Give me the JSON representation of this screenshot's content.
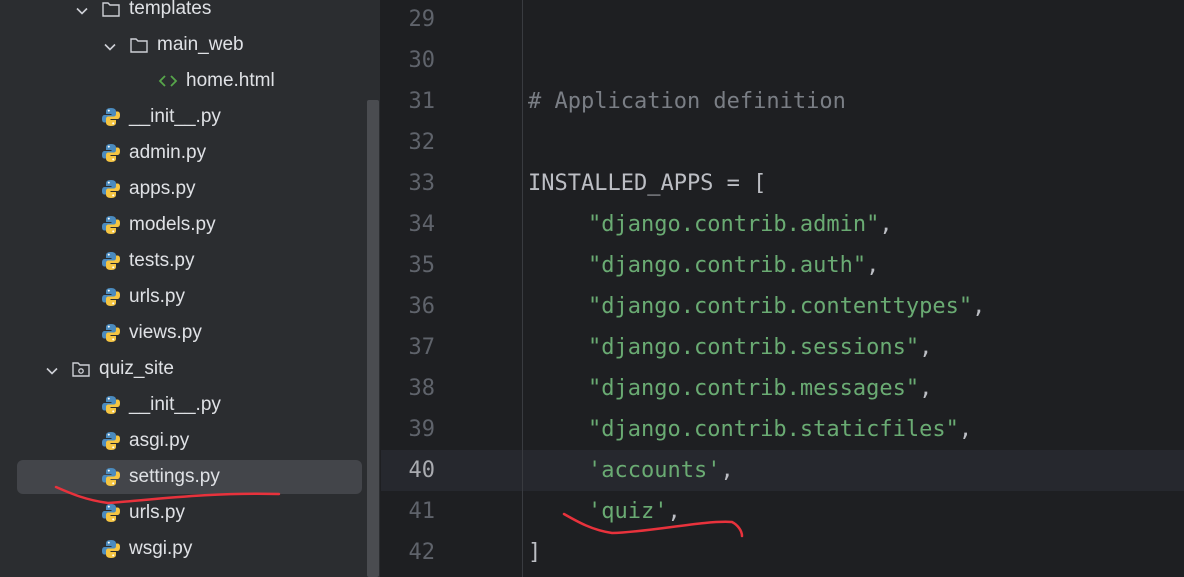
{
  "project_tree": {
    "items": [
      {
        "label": "templates",
        "kind": "folder",
        "expanded": true,
        "icon": "folder-icon"
      },
      {
        "label": "main_web",
        "kind": "folder",
        "expanded": true,
        "icon": "folder-icon"
      },
      {
        "label": "home.html",
        "kind": "html",
        "icon": "html-file-icon"
      },
      {
        "label": "__init__.py",
        "kind": "python",
        "icon": "python-file-icon"
      },
      {
        "label": "admin.py",
        "kind": "python",
        "icon": "python-file-icon"
      },
      {
        "label": "apps.py",
        "kind": "python",
        "icon": "python-file-icon"
      },
      {
        "label": "models.py",
        "kind": "python",
        "icon": "python-file-icon"
      },
      {
        "label": "tests.py",
        "kind": "python",
        "icon": "python-file-icon"
      },
      {
        "label": "urls.py",
        "kind": "python",
        "icon": "python-file-icon"
      },
      {
        "label": "views.py",
        "kind": "python",
        "icon": "python-file-icon"
      },
      {
        "label": "quiz_site",
        "kind": "package",
        "expanded": true,
        "icon": "package-folder-icon"
      },
      {
        "label": "__init__.py",
        "kind": "python",
        "icon": "python-file-icon"
      },
      {
        "label": "asgi.py",
        "kind": "python",
        "icon": "python-file-icon"
      },
      {
        "label": "settings.py",
        "kind": "python",
        "icon": "python-file-icon",
        "selected": true
      },
      {
        "label": "urls.py",
        "kind": "python",
        "icon": "python-file-icon"
      },
      {
        "label": "wsgi.py",
        "kind": "python",
        "icon": "python-file-icon"
      }
    ]
  },
  "editor": {
    "current_line": "40",
    "lines": [
      {
        "num": "29",
        "code": ""
      },
      {
        "num": "30",
        "code": ""
      },
      {
        "num": "31",
        "code": "# Application definition"
      },
      {
        "num": "32",
        "code": ""
      },
      {
        "num": "33",
        "code": "INSTALLED_APPS = ["
      },
      {
        "num": "34",
        "code": "\"django.contrib.admin\","
      },
      {
        "num": "35",
        "code": "\"django.contrib.auth\","
      },
      {
        "num": "36",
        "code": "\"django.contrib.contenttypes\","
      },
      {
        "num": "37",
        "code": "\"django.contrib.sessions\","
      },
      {
        "num": "38",
        "code": "\"django.contrib.messages\","
      },
      {
        "num": "39",
        "code": "\"django.contrib.staticfiles\","
      },
      {
        "num": "40",
        "code": "'accounts',"
      },
      {
        "num": "41",
        "code": "'quiz',"
      },
      {
        "num": "42",
        "code": "]"
      }
    ]
  },
  "colors": {
    "sidebar_bg": "#2b2d30",
    "editor_bg": "#1e1f22",
    "string_green": "#6aab73",
    "comment_gray": "#7a7e85",
    "annotation_red": "#e8323c",
    "python_blue": "#4b8bbe",
    "python_yellow": "#f5c542",
    "html_icon_green": "#57a64a"
  }
}
